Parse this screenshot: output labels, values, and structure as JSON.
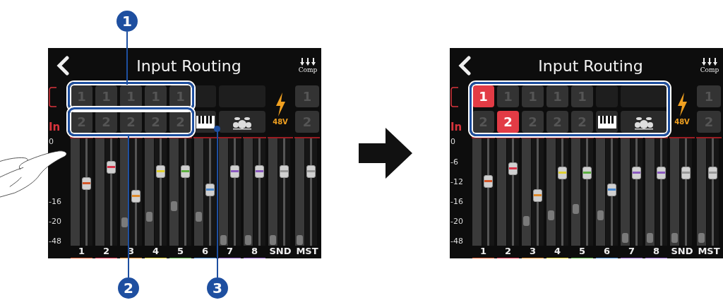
{
  "screens": [
    {
      "title": "Input Routing",
      "comp_label": "Comp",
      "input_label": "In",
      "scale": [
        "0",
        "-16",
        "-20",
        "-48"
      ],
      "routing": [
        {
          "top": {
            "label": "1",
            "selected": false
          },
          "bottom": {
            "label": "2",
            "selected": false
          }
        },
        {
          "top": {
            "label": "1",
            "selected": false
          },
          "bottom": {
            "label": "2",
            "selected": false
          }
        },
        {
          "top": {
            "label": "1",
            "selected": false
          },
          "bottom": {
            "label": "2",
            "selected": false
          }
        },
        {
          "top": {
            "label": "1",
            "selected": false
          },
          "bottom": {
            "label": "2",
            "selected": false
          }
        },
        {
          "top": {
            "label": "1",
            "selected": false
          },
          "bottom": {
            "label": "2",
            "selected": false
          }
        }
      ],
      "instruments": [
        {
          "kind": "keyboard"
        },
        {
          "kind": "drums"
        }
      ],
      "phantom": {
        "label": "48V"
      },
      "ext": [
        {
          "label": "1"
        },
        {
          "label": "2"
        }
      ],
      "channels": [
        {
          "label": "1",
          "color": "#d4572a",
          "fader": {
            "level": 0.58
          }
        },
        {
          "label": "2",
          "color": "#d9344a",
          "fader": {
            "level": 0.73
          }
        },
        {
          "label": "3",
          "color": "#e08a2a",
          "fader": {
            "level": 0.46
          },
          "marker": {
            "level": 0.22
          }
        },
        {
          "label": "4",
          "color": "#e0d030",
          "fader": {
            "level": 0.69
          },
          "marker": {
            "level": 0.27
          }
        },
        {
          "label": "5",
          "color": "#5cb040",
          "fader": {
            "level": 0.69
          },
          "marker": {
            "level": 0.37
          }
        },
        {
          "label": "6",
          "color": "#4a8ad0",
          "fader": {
            "level": 0.52
          },
          "marker": {
            "level": 0.27
          }
        },
        {
          "label": "7",
          "color": "#8a5ac0",
          "fader": {
            "level": 0.69
          },
          "marker": {
            "level": 0.05
          }
        },
        {
          "label": "8",
          "color": "#8a5ac0",
          "fader": {
            "level": 0.69
          },
          "marker": {
            "level": 0.05
          }
        },
        {
          "label": "SND",
          "fader": {
            "level": 0.69
          },
          "marker": {
            "level": 0.05
          }
        },
        {
          "label": "MST",
          "fader": {
            "level": 0.69
          },
          "marker": {
            "level": 0.05
          }
        }
      ],
      "highlights": [
        {
          "kind": "top-row"
        },
        {
          "kind": "bottom-row"
        }
      ]
    },
    {
      "title": "Input Routing",
      "comp_label": "Comp",
      "input_label": "In",
      "scale": [
        "0",
        "-6",
        "-12",
        "-16",
        "-20",
        "-48"
      ],
      "routing": [
        {
          "top": {
            "label": "1",
            "selected": true
          },
          "bottom": {
            "label": "2",
            "selected": false
          }
        },
        {
          "top": {
            "label": "1",
            "selected": false
          },
          "bottom": {
            "label": "2",
            "selected": true
          }
        },
        {
          "top": {
            "label": "1",
            "selected": false
          },
          "bottom": {
            "label": "2",
            "selected": false
          }
        },
        {
          "top": {
            "label": "1",
            "selected": false
          },
          "bottom": {
            "label": "2",
            "selected": false
          }
        },
        {
          "top": {
            "label": "1",
            "selected": false
          },
          "bottom": {
            "label": "2",
            "selected": false
          }
        }
      ],
      "instruments": [
        {
          "kind": "keyboard"
        },
        {
          "kind": "drums"
        }
      ],
      "phantom": {
        "label": "48V"
      },
      "ext": [
        {
          "label": "1"
        },
        {
          "label": "2"
        }
      ],
      "channels": [
        {
          "label": "1",
          "color": "#d4572a",
          "fader": {
            "level": 0.6
          }
        },
        {
          "label": "2",
          "color": "#d9344a",
          "fader": {
            "level": 0.72
          }
        },
        {
          "label": "3",
          "color": "#e08a2a",
          "fader": {
            "level": 0.47
          },
          "marker": {
            "level": 0.23
          }
        },
        {
          "label": "4",
          "color": "#e0d030",
          "fader": {
            "level": 0.68
          },
          "marker": {
            "level": 0.28
          }
        },
        {
          "label": "5",
          "color": "#5cb040",
          "fader": {
            "level": 0.68
          },
          "marker": {
            "level": 0.34
          }
        },
        {
          "label": "6",
          "color": "#4a8ad0",
          "fader": {
            "level": 0.52
          },
          "marker": {
            "level": 0.28
          }
        },
        {
          "label": "7",
          "color": "#8a5ac0",
          "fader": {
            "level": 0.68
          },
          "marker": {
            "level": 0.07
          }
        },
        {
          "label": "8",
          "color": "#8a5ac0",
          "fader": {
            "level": 0.68
          },
          "marker": {
            "level": 0.07
          }
        },
        {
          "label": "SND",
          "fader": {
            "level": 0.68
          },
          "marker": {
            "level": 0.07
          }
        },
        {
          "label": "MST",
          "fader": {
            "level": 0.68
          },
          "marker": {
            "level": 0.07
          }
        }
      ],
      "highlights": [
        {
          "kind": "both-rows"
        }
      ]
    }
  ],
  "markers": [
    {
      "number": "1"
    },
    {
      "number": "2"
    },
    {
      "number": "3"
    }
  ]
}
